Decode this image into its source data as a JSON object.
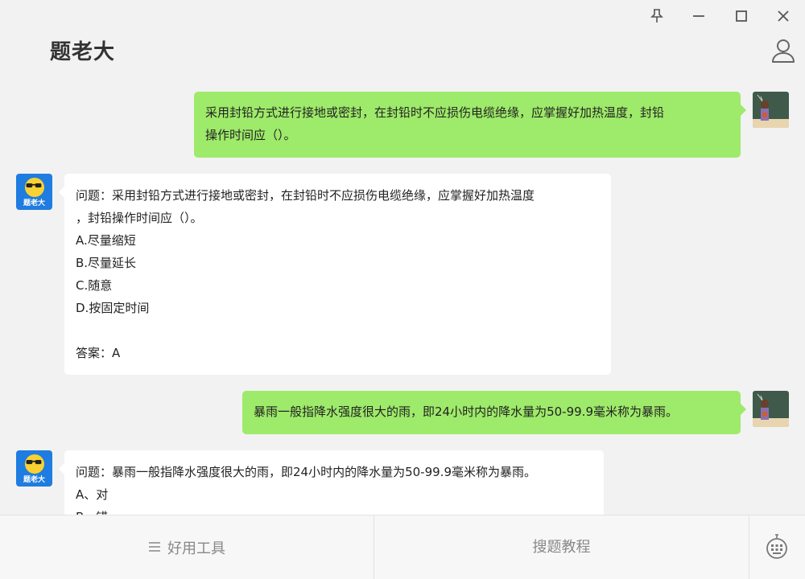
{
  "app": {
    "title": "题老大"
  },
  "window_controls": [
    "pin-icon",
    "minimize-icon",
    "maximize-icon",
    "close-icon"
  ],
  "colors": {
    "user_bubble": "#9eea6a",
    "bot_bubble": "#ffffff",
    "background": "#f2f2f2",
    "bot_avatar": "#1f7ce0"
  },
  "bot": {
    "avatar_label": "题老大"
  },
  "messages": [
    {
      "role": "user",
      "lines": [
        "采用封铅方式进行接地或密封，在封铅时不应损伤电缆绝缘，应掌握好加热温度，封铅",
        "操作时间应（）。"
      ]
    },
    {
      "role": "bot",
      "lines": [
        "问题：采用封铅方式进行接地或密封，在封铅时不应损伤电缆绝缘，应掌握好加热温度",
        "，封铅操作时间应（）。",
        "A.尽量缩短",
        "B.尽量延长",
        "C.随意",
        "D.按固定时间",
        "",
        "答案：A"
      ]
    },
    {
      "role": "user",
      "lines": [
        "暴雨一般指降水强度很大的雨，即24小时内的降水量为50-99.9毫米称为暴雨。"
      ]
    },
    {
      "role": "bot",
      "lines": [
        "问题：暴雨一般指降水强度很大的雨，即24小时内的降水量为50-99.9毫米称为暴雨。",
        "A、对",
        "B、错"
      ]
    }
  ],
  "bottom_bar": {
    "tools_label": "好用工具",
    "tutorial_label": "搜题教程"
  }
}
